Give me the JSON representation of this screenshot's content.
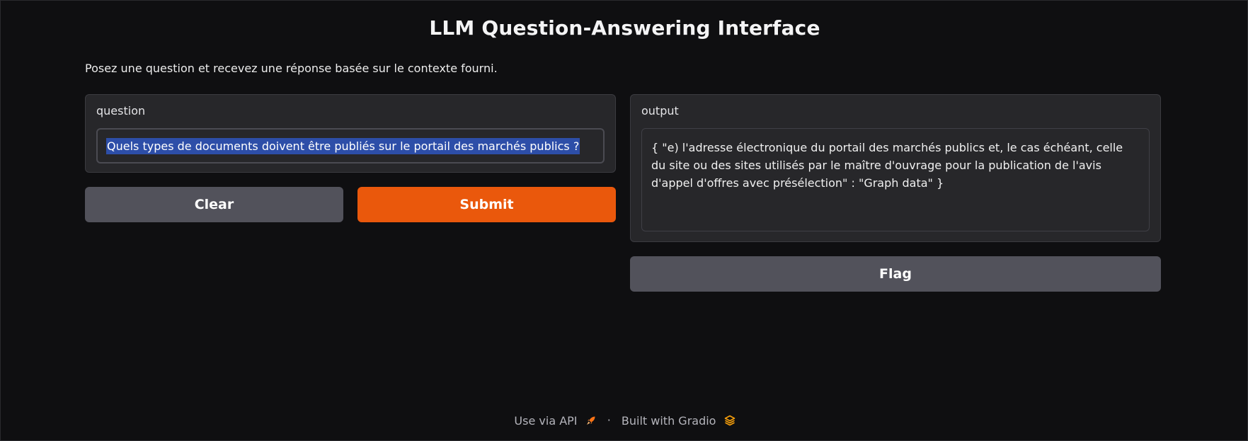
{
  "app": {
    "title": "LLM Question-Answering Interface",
    "description": "Posez une question et recevez une réponse basée sur le contexte fourni."
  },
  "question": {
    "label": "question",
    "value": "Quels types de documents doivent être publiés sur le portail des marchés publics ?"
  },
  "output": {
    "label": "output",
    "value": "{ \"e) l'adresse électronique du portail des marchés publics et, le cas échéant, celle du site ou des sites utilisés par le maître d'ouvrage pour la publication de l'avis d'appel d'offres avec présélection\" : \"Graph data\" }"
  },
  "buttons": {
    "clear": "Clear",
    "submit": "Submit",
    "flag": "Flag"
  },
  "footer": {
    "api_link": "Use via API",
    "separator": "·",
    "built_with": "Built with Gradio"
  },
  "icons": {
    "api": "rocket-icon",
    "gradio": "gradio-logo-icon"
  },
  "colors": {
    "background": "#0f0f11",
    "panel": "#27272a",
    "primary_button": "#ea580c",
    "secondary_button": "#52525b",
    "selection_highlight": "#2d4ea8"
  }
}
